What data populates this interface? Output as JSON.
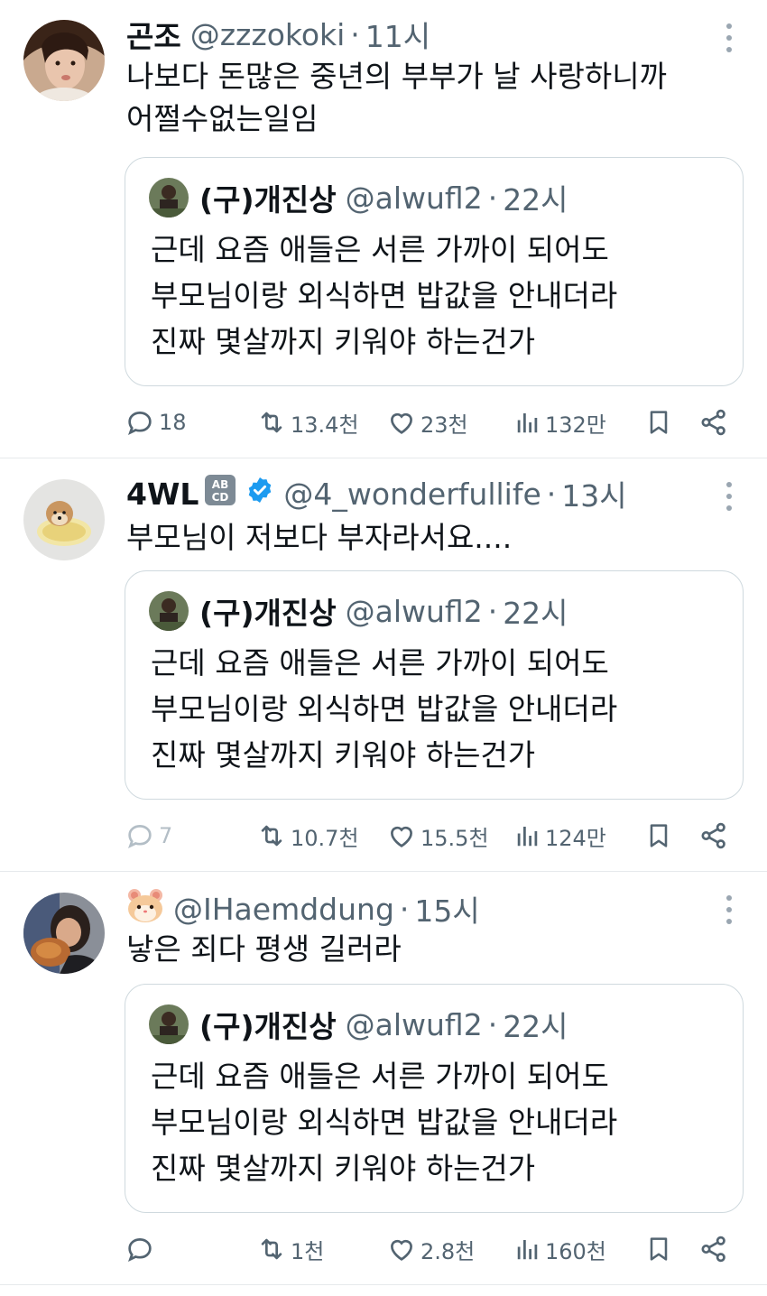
{
  "tweets": [
    {
      "name": "곤조",
      "handle": "@zzzokoki",
      "time": "11시",
      "text_lines": [
        "나보다 돈많은 중년의 부부가 날 사랑하니까",
        "어쩔수없는일임"
      ],
      "quote": {
        "name": "(구)개진상",
        "handle": "@alwufl2",
        "time": "22시",
        "text_lines": [
          "근데 요즘 애들은 서른 가까이 되어도",
          "부모님이랑 외식하면 밥값을 안내더라",
          "진짜 몇살까지 키워야 하는건가"
        ]
      },
      "replies": "18",
      "retweets": "13.4천",
      "likes": "23천",
      "views": "132만"
    },
    {
      "name": "4WL",
      "name_badge": "🔤",
      "verified": true,
      "handle": "@4_wonderfullife",
      "time": "13시",
      "text_lines": [
        "부모님이 저보다 부자라서요...."
      ],
      "quote": {
        "name": "(구)개진상",
        "handle": "@alwufl2",
        "time": "22시",
        "text_lines": [
          "근데 요즘 애들은 서른 가까이 되어도",
          "부모님이랑 외식하면 밥값을 안내더라",
          "진짜 몇살까지 키워야 하는건가"
        ]
      },
      "replies": "7",
      "retweets": "10.7천",
      "likes": "15.5천",
      "views": "124만"
    },
    {
      "name": "",
      "name_badge": "🐹",
      "handle": "@IHaemddung",
      "time": "15시",
      "text_lines": [
        "낳은 죄다 평생 길러라"
      ],
      "quote": {
        "name": "(구)개진상",
        "handle": "@alwufl2",
        "time": "22시",
        "text_lines": [
          "근데 요즘 애들은 서른 가까이 되어도",
          "부모님이랑 외식하면 밥값을 안내더라",
          "진짜 몇살까지 키워야 하는건가"
        ]
      },
      "replies": "",
      "retweets": "1천",
      "likes": "2.8천",
      "views": "160천"
    }
  ],
  "icons": {
    "reply": "speech-bubble-icon",
    "retweet": "retweet-icon",
    "like": "heart-icon",
    "views": "bar-chart-icon",
    "bookmark": "bookmark-icon",
    "share": "share-icon",
    "more": "more-vertical-icon",
    "verified": "verified-badge-icon"
  },
  "colors": {
    "text": "#0f1419",
    "secondary": "#536471",
    "verified": "#1d9bf0",
    "border": "#cfd9de"
  }
}
